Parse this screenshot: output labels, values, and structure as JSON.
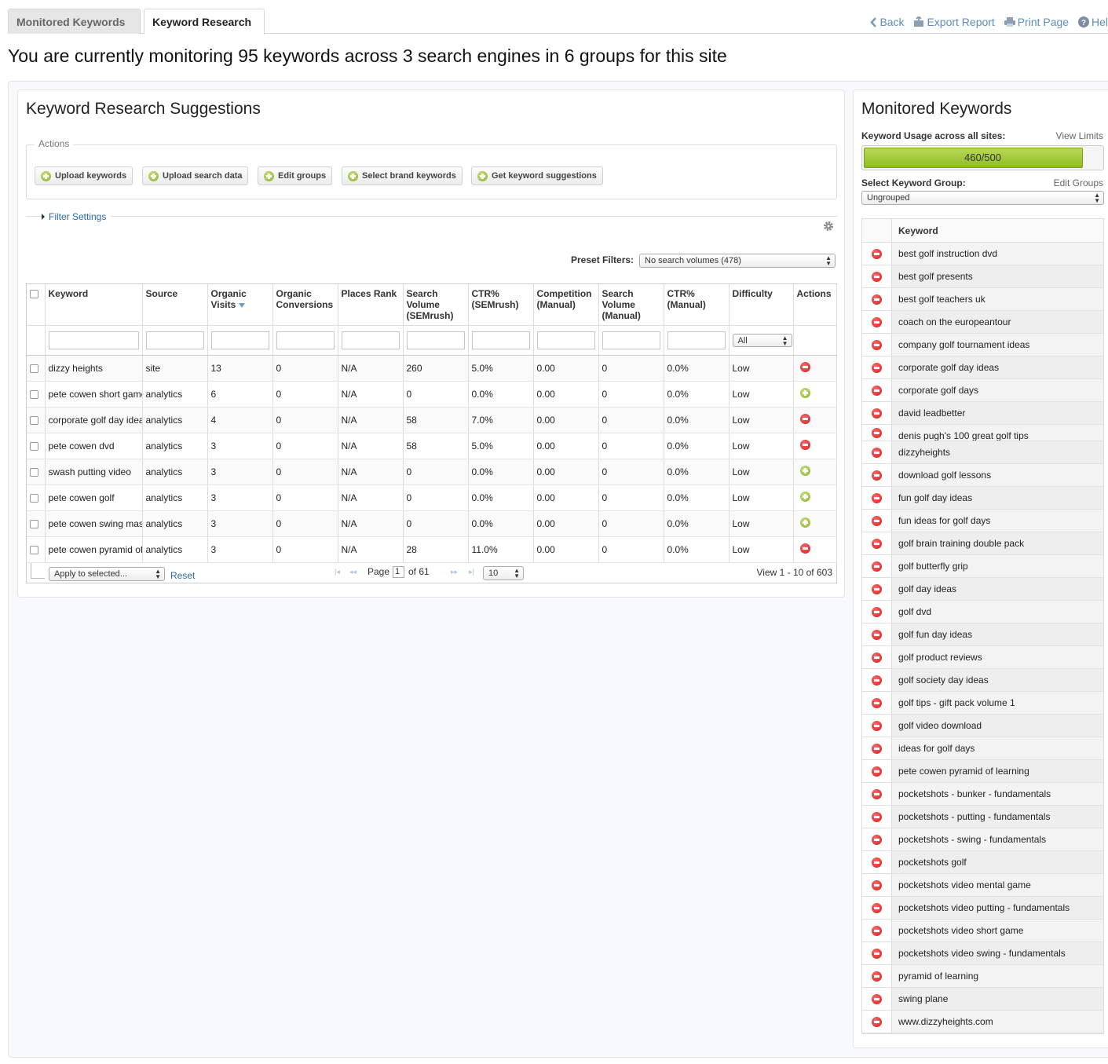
{
  "tabs": [
    {
      "label": "Monitored Keywords",
      "active": false
    },
    {
      "label": "Keyword Research",
      "active": true
    }
  ],
  "toolbar": {
    "back": "Back",
    "export": "Export Report",
    "print": "Print Page",
    "help": "Hel"
  },
  "headline": "You are currently monitoring 95 keywords across 3 search engines in 6 groups for this site",
  "research": {
    "title": "Keyword Research Suggestions",
    "actions_legend": "Actions",
    "buttons": [
      "Upload keywords",
      "Upload search data",
      "Edit groups",
      "Select brand keywords",
      "Get keyword suggestions"
    ],
    "filter_settings": "Filter Settings",
    "preset_label": "Preset Filters:",
    "preset_value": "No search volumes (478)",
    "columns": [
      "Keyword",
      "Source",
      "Organic Visits",
      "Organic Conversions",
      "Places Rank",
      "Search Volume (SEMrush)",
      "CTR% (SEMrush)",
      "Competition (Manual)",
      "Search Volume (Manual)",
      "CTR% (Manual)",
      "Difficulty",
      "Actions"
    ],
    "difficulty_filter": "All",
    "rows": [
      {
        "keyword": "dizzy heights",
        "source": "site",
        "visits": "13",
        "conversions": "0",
        "places": "N/A",
        "places_link": true,
        "volume": "260",
        "ctr": "5.0%",
        "competition": "0.00",
        "volume_manual": "0",
        "ctr_manual": "0.0%",
        "difficulty": "Low",
        "action": "remove"
      },
      {
        "keyword": "pete cowen short game",
        "source": "analytics",
        "visits": "6",
        "conversions": "0",
        "places": "N/A",
        "places_link": false,
        "volume": "0",
        "ctr": "0.0%",
        "competition": "0.00",
        "volume_manual": "0",
        "ctr_manual": "0.0%",
        "difficulty": "Low",
        "action": "add"
      },
      {
        "keyword": "corporate golf day ideas",
        "source": "analytics",
        "visits": "4",
        "conversions": "0",
        "places": "N/A",
        "places_link": true,
        "volume": "58",
        "ctr": "7.0%",
        "competition": "0.00",
        "volume_manual": "0",
        "ctr_manual": "0.0%",
        "difficulty": "Low",
        "action": "remove"
      },
      {
        "keyword": "pete cowen dvd",
        "source": "analytics",
        "visits": "3",
        "conversions": "0",
        "places": "N/A",
        "places_link": true,
        "volume": "58",
        "ctr": "5.0%",
        "competition": "0.00",
        "volume_manual": "0",
        "ctr_manual": "0.0%",
        "difficulty": "Low",
        "action": "remove"
      },
      {
        "keyword": "swash putting video",
        "source": "analytics",
        "visits": "3",
        "conversions": "0",
        "places": "N/A",
        "places_link": false,
        "volume": "0",
        "ctr": "0.0%",
        "competition": "0.00",
        "volume_manual": "0",
        "ctr_manual": "0.0%",
        "difficulty": "Low",
        "action": "add"
      },
      {
        "keyword": "pete cowen golf",
        "source": "analytics",
        "visits": "3",
        "conversions": "0",
        "places": "N/A",
        "places_link": false,
        "volume": "0",
        "ctr": "0.0%",
        "competition": "0.00",
        "volume_manual": "0",
        "ctr_manual": "0.0%",
        "difficulty": "Low",
        "action": "add"
      },
      {
        "keyword": "pete cowen swing masterclass",
        "source": "analytics",
        "visits": "3",
        "conversions": "0",
        "places": "N/A",
        "places_link": false,
        "volume": "0",
        "ctr": "0.0%",
        "competition": "0.00",
        "volume_manual": "0",
        "ctr_manual": "0.0%",
        "difficulty": "Low",
        "action": "add"
      },
      {
        "keyword": "pete cowen pyramid of learning",
        "source": "analytics",
        "visits": "3",
        "conversions": "0",
        "places": "N/A",
        "places_link": true,
        "volume": "28",
        "ctr": "11.0%",
        "competition": "0.00",
        "volume_manual": "0",
        "ctr_manual": "0.0%",
        "difficulty": "Low",
        "action": "remove"
      }
    ],
    "pager": {
      "apply": "Apply to selected...",
      "reset": "Reset",
      "page_label": "Page",
      "page": "1",
      "of": "of 61",
      "per_page": "10",
      "view": "View 1 - 10 of 603"
    }
  },
  "monitored": {
    "title": "Monitored Keywords",
    "usage_label": "Keyword Usage across all sites:",
    "view_limits": "View Limits",
    "usage_text": "460/500",
    "usage_fraction": 0.92,
    "group_label": "Select Keyword Group:",
    "edit_groups": "Edit Groups",
    "group_value": "Ungrouped",
    "column": "Keyword",
    "keywords": [
      "best golf instruction dvd",
      "best golf presents",
      "best golf teachers uk",
      "coach on the europeantour",
      "company golf tournament ideas",
      "corporate golf day ideas",
      "corporate golf days",
      "david leadbetter",
      "denis pugh's 100 great golf tips",
      "dizzyheights",
      "download golf lessons",
      "fun golf day ideas",
      "fun ideas for golf days",
      "golf brain training double pack",
      "golf butterfly grip",
      "golf day ideas",
      "golf dvd",
      "golf fun day ideas",
      "golf product reviews",
      "golf society day ideas",
      "golf tips - gift pack volume 1",
      "golf video download",
      "ideas for golf days",
      "pete cowen pyramid of learning",
      "pocketshots - bunker - fundamentals",
      "pocketshots - putting - fundamentals",
      "pocketshots - swing - fundamentals",
      "pocketshots golf",
      "pocketshots video mental game",
      "pocketshots video putting - fundamentals",
      "pocketshots video short game",
      "pocketshots video swing - fundamentals",
      "pyramid of learning",
      "swing plane",
      "www.dizzyheights.com"
    ]
  }
}
